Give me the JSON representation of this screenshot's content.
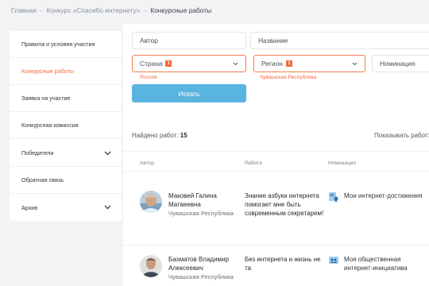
{
  "breadcrumb": {
    "items": [
      "Главная",
      "Конкурс «Спасибо интернету»",
      "Конкурсные работы"
    ],
    "separator": "–"
  },
  "sidebar": {
    "items": [
      {
        "label": "Правила и условия участия",
        "active": false,
        "expandable": false
      },
      {
        "label": "Конкурсные работы",
        "active": true,
        "expandable": false
      },
      {
        "label": "Заявка на участие",
        "active": false,
        "expandable": false
      },
      {
        "label": "Конкурсная комиссия",
        "active": false,
        "expandable": false
      },
      {
        "label": "Победители",
        "active": false,
        "expandable": true
      },
      {
        "label": "Обратная связь",
        "active": false,
        "expandable": false
      },
      {
        "label": "Архив",
        "active": false,
        "expandable": true
      }
    ]
  },
  "filters": {
    "author_placeholder": "Автор",
    "title_placeholder": "Название",
    "country": {
      "label": "Страна",
      "count": "1",
      "selected": "Россия"
    },
    "region": {
      "label": "Регион",
      "count": "1",
      "selected": "Чувашская Республика"
    },
    "nomination": {
      "label": "Номинация"
    },
    "search_label": "Искать"
  },
  "results": {
    "found_label": "Найдено работ:",
    "found_count": "15",
    "show_label": "Показывать работ:"
  },
  "table": {
    "headers": [
      "Автор",
      "Работа",
      "Номинация"
    ],
    "rows": [
      {
        "author": "Маковей Галина Матвеевна",
        "region": "Чувашская Республика",
        "work": "Знание азбуки интернета помогает мне быть современным секретарем!",
        "nomination": "Мои интернет-достижения"
      },
      {
        "author": "Бахматов Владимир Алексеевич",
        "region": "Чувашская Республика",
        "work": "Без интернета и жизнь не та",
        "nomination": "Моя общественная интернет-инициатива"
      }
    ]
  },
  "colors": {
    "accent": "#f06a3c",
    "button": "#5ab4e0",
    "background": "#f2f3f5"
  }
}
